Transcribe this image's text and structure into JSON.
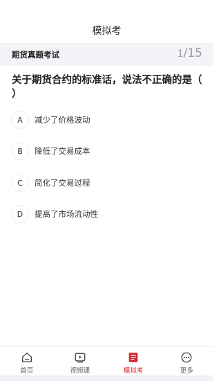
{
  "header": {
    "title": "模拟考"
  },
  "exam": {
    "name": "期货真题考试",
    "current": "1",
    "total": "/15"
  },
  "question": {
    "text": "关于期货合约的标准话，说法不正确的是（ ）",
    "options": [
      {
        "letter": "A",
        "text": "减少了价格波动"
      },
      {
        "letter": "B",
        "text": "降低了交易成本"
      },
      {
        "letter": "C",
        "text": "简化了交易过程"
      },
      {
        "letter": "D",
        "text": "提高了市场流动性"
      }
    ]
  },
  "tabbar": {
    "items": [
      {
        "label": "首页",
        "icon": "home-icon"
      },
      {
        "label": "视频课",
        "icon": "video-icon"
      },
      {
        "label": "模拟考",
        "icon": "exam-icon",
        "active": true
      },
      {
        "label": "更多",
        "icon": "more-icon"
      }
    ],
    "active_color": "#d8222f"
  }
}
